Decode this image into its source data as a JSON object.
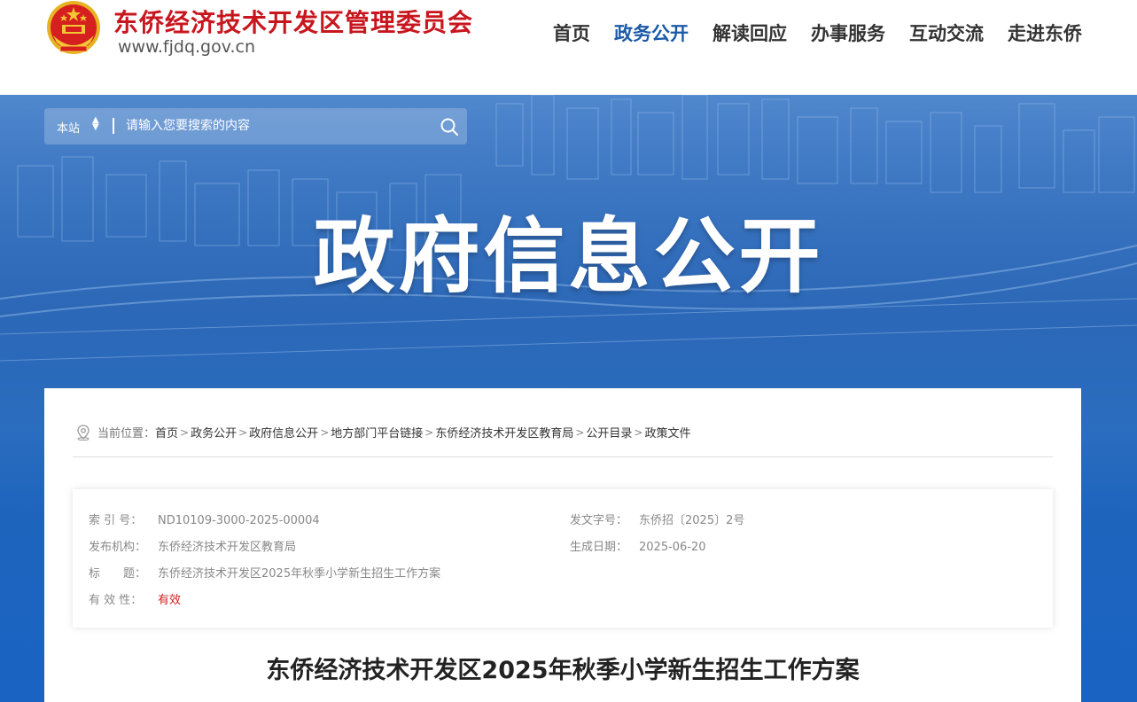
{
  "header": {
    "site_title": "东侨经济技术开发区管理委员会",
    "site_url": "www.fjdq.gov.cn",
    "nav": [
      {
        "label": "首页",
        "active": false
      },
      {
        "label": "政务公开",
        "active": true
      },
      {
        "label": "解读回应",
        "active": false
      },
      {
        "label": "办事服务",
        "active": false
      },
      {
        "label": "互动交流",
        "active": false
      },
      {
        "label": "走进东侨",
        "active": false
      }
    ]
  },
  "search": {
    "scope": "本站",
    "placeholder": "请输入您要搜索的内容"
  },
  "banner": {
    "title": "政府信息公开"
  },
  "breadcrumb": {
    "prefix": "当前位置：",
    "items": [
      "首页",
      "政务公开",
      "政府信息公开",
      "地方部门平台链接",
      "东侨经济技术开发区教育局",
      "公开目录",
      "政策文件"
    ],
    "separator": ">"
  },
  "info": {
    "index_no_label": "索 引 号：",
    "index_no": "ND10109-3000-2025-00004",
    "doc_no_label": "发文字号：",
    "doc_no": "东侨招〔2025〕2号",
    "publisher_label": "发布机构：",
    "publisher": "东侨经济技术开发区教育局",
    "date_label": "生成日期：",
    "date": "2025-06-20",
    "title_label": "标　　题：",
    "title": "东侨经济技术开发区2025年秋季小学新生招生工作方案",
    "validity_label": "有 效 性：",
    "validity": "有效"
  },
  "article": {
    "title": "东侨经济技术开发区2025年秋季小学新生招生工作方案"
  },
  "colors": {
    "brand_red": "#c8161e",
    "nav_active": "#1a5aa8",
    "banner_blue": "#2a66b6",
    "valid_red": "#d21e1e"
  }
}
